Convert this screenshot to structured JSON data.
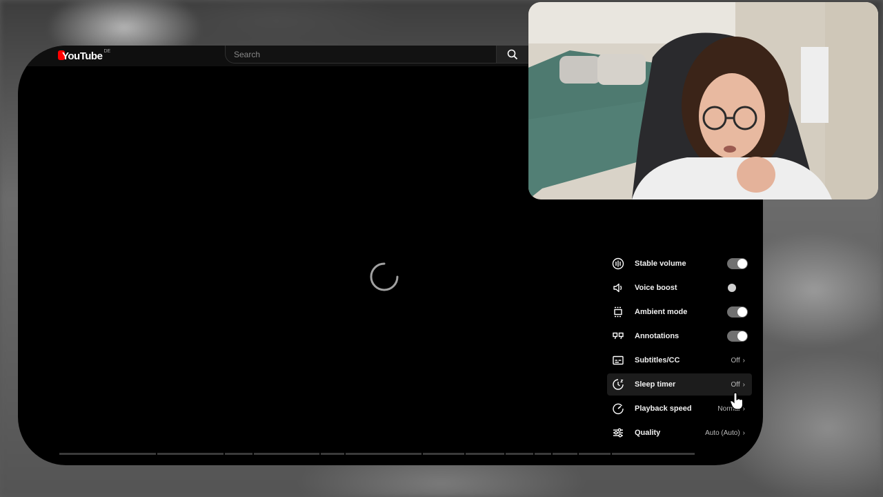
{
  "header": {
    "logo_text": "YouTube",
    "logo_country": "DE",
    "search_placeholder": "Search"
  },
  "settings": {
    "items": [
      {
        "label": "Stable volume",
        "icon": "stable-volume-icon",
        "control": "toggle",
        "state": "on"
      },
      {
        "label": "Voice boost",
        "icon": "voice-boost-icon",
        "control": "toggle",
        "state": "off"
      },
      {
        "label": "Ambient mode",
        "icon": "ambient-mode-icon",
        "control": "toggle",
        "state": "on"
      },
      {
        "label": "Annotations",
        "icon": "annotations-icon",
        "control": "toggle",
        "state": "on"
      },
      {
        "label": "Subtitles/CC",
        "icon": "subtitles-icon",
        "control": "value",
        "value": "Off"
      },
      {
        "label": "Sleep timer",
        "icon": "sleep-timer-icon",
        "control": "value",
        "value": "Off"
      },
      {
        "label": "Playback speed",
        "icon": "playback-speed-icon",
        "control": "value",
        "value": "Normal"
      },
      {
        "label": "Quality",
        "icon": "quality-icon",
        "control": "value",
        "value": "Auto (Auto)"
      }
    ]
  },
  "colors": {
    "accent": "#ff0000",
    "panel_text": "#f1f1f1",
    "toggle_track": "#717171"
  }
}
